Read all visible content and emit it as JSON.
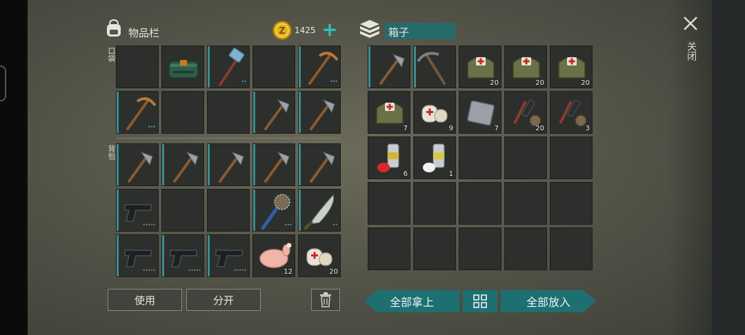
{
  "inventory": {
    "title": "物品栏",
    "coins": "1425",
    "coin_symbol": "Z",
    "plus_label": "+",
    "pocket_label": "口袋",
    "backpack_label": "背包",
    "pocket_slots": [
      {
        "item": "empty"
      },
      {
        "item": "dynamite-bundle"
      },
      {
        "item": "sledgehammer",
        "bar": true,
        "dots": "••"
      },
      {
        "item": "empty"
      },
      {
        "item": "pickaxe",
        "bar": true,
        "dots": "•••"
      },
      {
        "item": "pickaxe",
        "bar": true,
        "dots": "•••"
      },
      {
        "item": "empty"
      },
      {
        "item": "empty"
      },
      {
        "item": "hatchet",
        "bar": true
      },
      {
        "item": "hatchet",
        "bar": true
      }
    ],
    "backpack_slots": [
      {
        "item": "hatchet",
        "bar": true
      },
      {
        "item": "hatchet",
        "bar": true
      },
      {
        "item": "hatchet",
        "bar": true
      },
      {
        "item": "hatchet",
        "bar": true
      },
      {
        "item": "hatchet",
        "bar": true
      },
      {
        "item": "pistol",
        "bar": true,
        "dots": "•••••",
        "grey": true
      },
      {
        "item": "empty"
      },
      {
        "item": "empty"
      },
      {
        "item": "spiked-club",
        "bar": true,
        "dots": "•••"
      },
      {
        "item": "machete",
        "bar": true,
        "dots": "••",
        "grey": true
      },
      {
        "item": "pistol",
        "bar": true,
        "dots": "•••••",
        "grey": true
      },
      {
        "item": "pistol",
        "bar": true,
        "dots": "•••••",
        "grey": true
      },
      {
        "item": "pistol",
        "bar": true,
        "dots": "•••••",
        "grey": true
      },
      {
        "item": "raw-chicken",
        "count": "12"
      },
      {
        "item": "bandage",
        "count": "20"
      }
    ],
    "buttons": {
      "use": "使用",
      "split": "分开"
    }
  },
  "chest": {
    "title": "箱子",
    "slots": [
      {
        "item": "hatchet",
        "bar": true
      },
      {
        "item": "pickaxe-dark",
        "bar": true
      },
      {
        "item": "medkit-bag",
        "count": "20"
      },
      {
        "item": "medkit-bag",
        "count": "20"
      },
      {
        "item": "medkit-bag",
        "count": "20"
      },
      {
        "item": "medkit-bag",
        "count": "7"
      },
      {
        "item": "bandage",
        "count": "9"
      },
      {
        "item": "metal-plate",
        "count": "7"
      },
      {
        "item": "gun-parts",
        "count": "20"
      },
      {
        "item": "gun-parts",
        "count": "3"
      },
      {
        "item": "spray-can-red",
        "count": "6"
      },
      {
        "item": "spray-can-white",
        "count": "1"
      },
      {
        "item": "empty"
      },
      {
        "item": "empty"
      },
      {
        "item": "empty"
      },
      {
        "item": "empty"
      },
      {
        "item": "empty"
      },
      {
        "item": "empty"
      },
      {
        "item": "empty"
      },
      {
        "item": "empty"
      },
      {
        "item": "empty"
      },
      {
        "item": "empty"
      },
      {
        "item": "empty"
      },
      {
        "item": "empty"
      },
      {
        "item": "empty"
      }
    ],
    "buttons": {
      "take_all": "全部拿上",
      "put_all": "全部放入"
    }
  },
  "close_label": "关闭",
  "colors": {
    "teal": "#1e6f72",
    "slot": "#2c2f2c",
    "durability": "#3c8c92",
    "coin": "#e3b21a"
  }
}
